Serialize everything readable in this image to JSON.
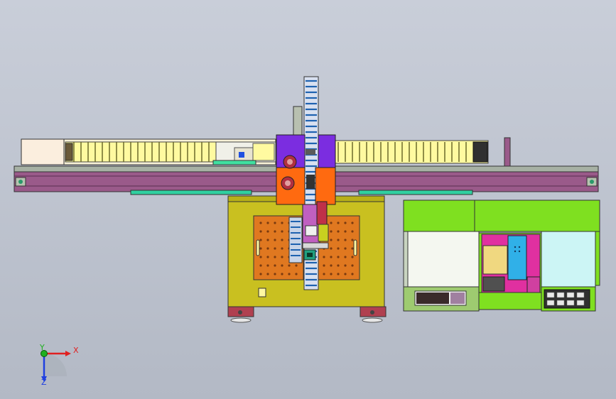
{
  "viewport": {
    "background_top": "#c9ced9",
    "background_bottom": "#b3b9c5"
  },
  "triad": {
    "x_label": "X",
    "y_label": "Y",
    "z_label": "Z",
    "x_color": "#e02020",
    "y_color": "#20b020",
    "z_color": "#2040e0"
  },
  "model": {
    "name": "gantry-machine-assembly",
    "colors": {
      "rail": "#9a5a8a",
      "rail_top": "#a7b1a4",
      "belt": "#fff59a",
      "base": "#c9c020",
      "plate": "#e07820",
      "carriage_purple": "#7b2de0",
      "carriage_orange": "#ff6a10",
      "chain": "#3a8ad0",
      "cabinet_green": "#7fe020",
      "cabinet_white": "#f4f7f0",
      "panel_pink": "#e030a0",
      "panel_cyan": "#30c0e0"
    }
  }
}
